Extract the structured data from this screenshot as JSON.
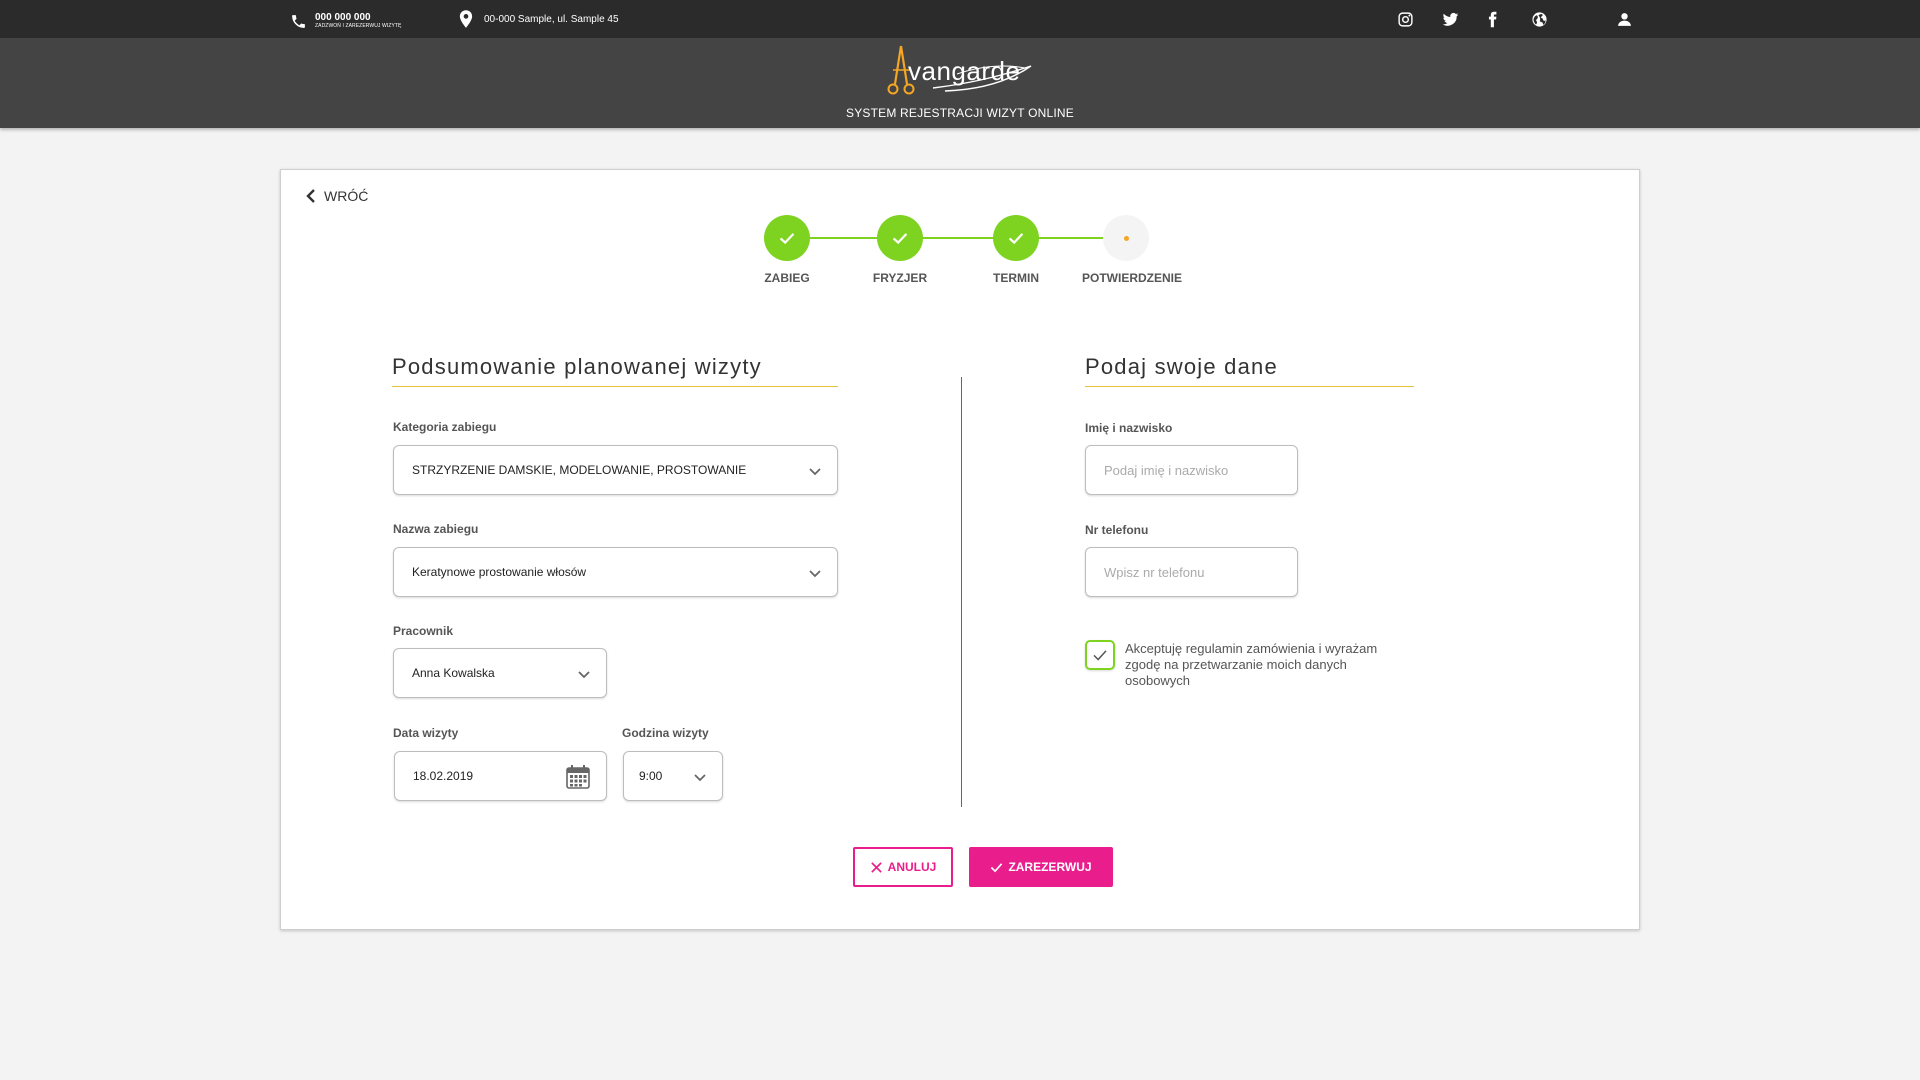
{
  "topbar": {
    "phone_number": "000 000 000",
    "phone_sub": "ZADZWOŃ I ZAREZERWUJ WIZYTĘ",
    "address": "00-000 Sample, ul. Sample 45",
    "icons": [
      "phone-icon",
      "map-pin-icon",
      "instagram-icon",
      "twitter-icon",
      "facebook-icon",
      "globe-icon",
      "user-icon"
    ]
  },
  "header": {
    "logo_text": "vangarde",
    "subtitle": "SYSTEM REJESTRACJI WIZYT ONLINE"
  },
  "nav": {
    "back_label": "WRÓĆ"
  },
  "stepper": {
    "steps": [
      {
        "label": "ZABIEG",
        "status": "done"
      },
      {
        "label": "FRYZJER",
        "status": "done"
      },
      {
        "label": "TERMIN",
        "status": "done"
      },
      {
        "label": "POTWIERDZENIE",
        "status": "current"
      }
    ]
  },
  "summary": {
    "title": "Podsumowanie planowanej wizyty",
    "category_label": "Kategoria zabiegu",
    "category_value": "STRZYRZENIE DAMSKIE, MODELOWANIE, PROSTOWANIE",
    "service_label": "Nazwa zabiegu",
    "service_value": "Keratynowe prostowanie włosów",
    "employee_label": "Pracownik",
    "employee_value": "Anna Kowalska",
    "date_label": "Data wizyty",
    "date_value": "18.02.2019",
    "time_label": "Godzina wizyty",
    "time_value": "9:00"
  },
  "form": {
    "title": "Podaj swoje dane",
    "name_label": "Imię i nazwisko",
    "name_placeholder": "Podaj imię i nazwisko",
    "phone_label": "Nr telefonu",
    "phone_placeholder": "Wpisz nr telefonu",
    "consent_text": "Akceptuję regulamin zamówienia i wyrażam zgodę na przetwarzanie moich danych osobowych",
    "consent_checked": true
  },
  "actions": {
    "cancel_label": "ANULUJ",
    "confirm_label": "ZAREZERWUJ"
  },
  "colors": {
    "accent_green": "#7ed321",
    "accent_pink": "#e91e8c",
    "accent_gold": "#e6c43a",
    "pending_dot": "#f5a623"
  }
}
